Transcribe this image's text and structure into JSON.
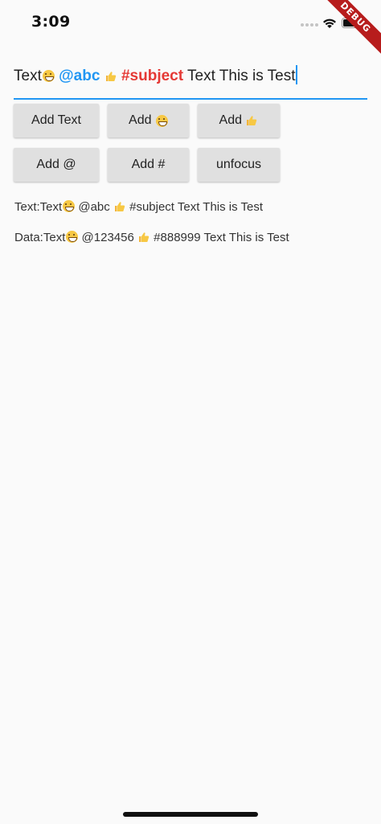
{
  "status_bar": {
    "time": "3:09",
    "debug_label": "DEBUG"
  },
  "text_field": {
    "segments": [
      {
        "text": "Text",
        "style": "plain"
      },
      {
        "text": "grin-emoji",
        "style": "emoji"
      },
      {
        "text": " ",
        "style": "plain"
      },
      {
        "text": "@abc",
        "style": "mention"
      },
      {
        "text": " ",
        "style": "plain"
      },
      {
        "text": "thumbs-up-emoji",
        "style": "emoji"
      },
      {
        "text": " ",
        "style": "plain"
      },
      {
        "text": "#subject",
        "style": "topic"
      },
      {
        "text": " Text This is Test",
        "style": "plain"
      }
    ],
    "mention_color": "#2196f3",
    "topic_color": "#e53935",
    "underline_color": "#2196f3"
  },
  "buttons": {
    "add_text": "Add Text",
    "add_emoji_prefix": "Add ",
    "add_thumb_prefix": "Add ",
    "add_at": "Add @",
    "add_hash": "Add #",
    "unfocus": "unfocus"
  },
  "output": {
    "text_prefix": "Text:Text",
    "text_mid": " @abc ",
    "text_suffix": " #subject Text This is Test",
    "data_prefix": "Data:Text",
    "data_mid": " @123456 ",
    "data_suffix": " #888999 Text This is Test"
  }
}
